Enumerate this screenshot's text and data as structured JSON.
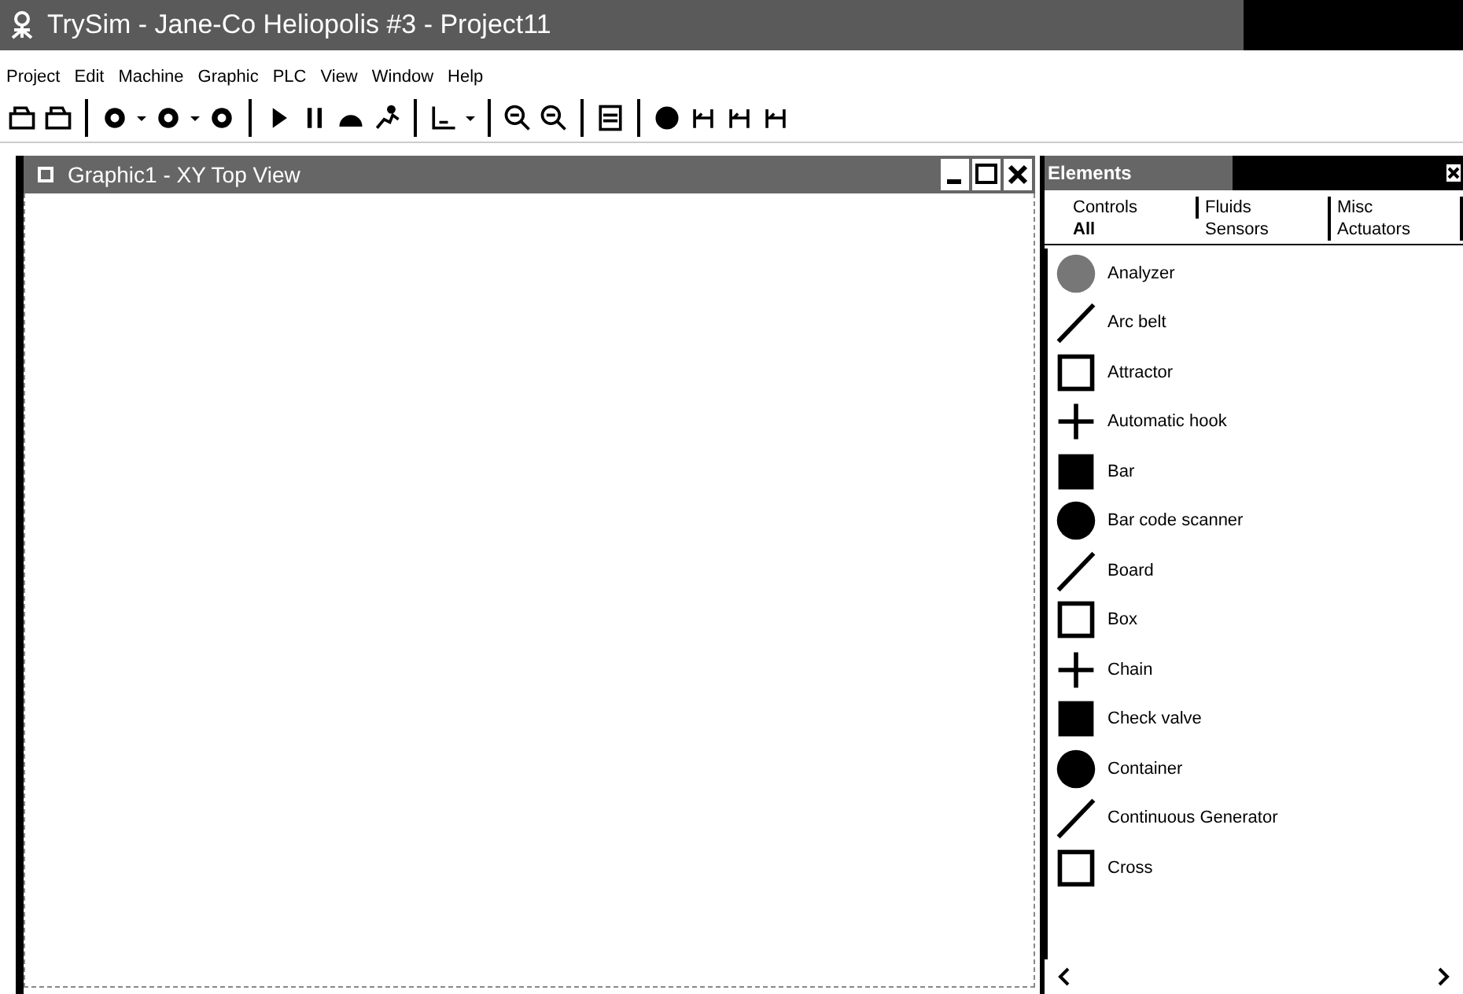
{
  "window": {
    "title": "TrySim - Jane-Co Heliopolis #3 - Project11"
  },
  "menu": [
    "Project",
    "Edit",
    "Machine",
    "Graphic",
    "PLC",
    "View",
    "Window",
    "Help"
  ],
  "graphic_window": {
    "title": "Graphic1 -  XY Top View"
  },
  "elements_panel": {
    "title": "Elements",
    "tab_rows": [
      [
        {
          "label": "Controls",
          "selected": false
        },
        {
          "label": "Fluids",
          "selected": false
        },
        {
          "label": "Misc",
          "selected": false
        }
      ],
      [
        {
          "label": "All",
          "selected": true
        },
        {
          "label": "Sensors",
          "selected": false
        },
        {
          "label": "Actuators",
          "selected": false
        }
      ]
    ],
    "items": [
      "Analyzer",
      "Arc belt",
      "Attractor",
      "Automatic hook",
      "Bar",
      "Bar code scanner",
      "Board",
      "Box",
      "Chain",
      "Check valve",
      "Container",
      "Continuous Generator",
      "Cross"
    ]
  }
}
